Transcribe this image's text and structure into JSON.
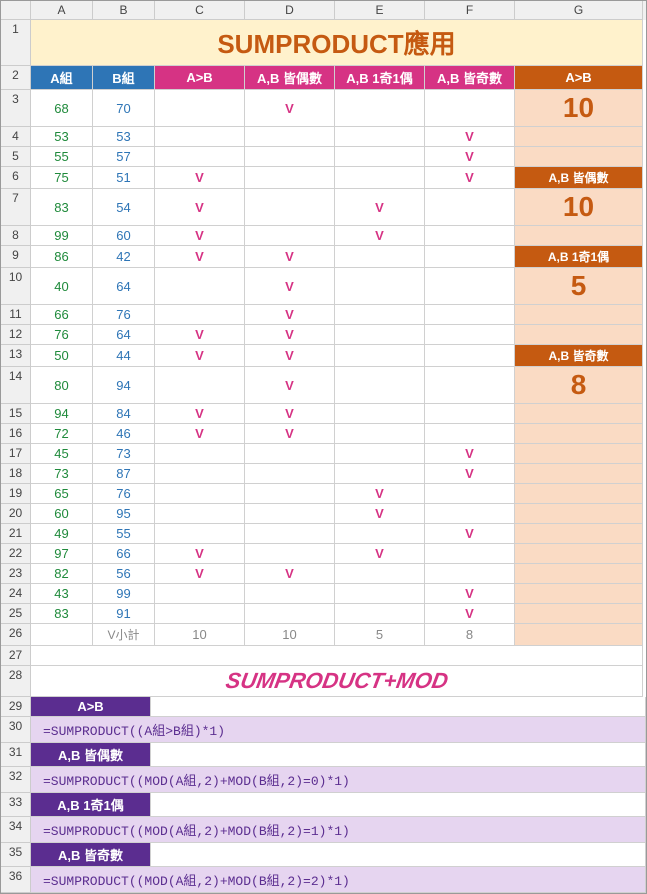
{
  "columns": [
    "",
    "A",
    "B",
    "C",
    "D",
    "E",
    "F",
    "G"
  ],
  "title": "SUMPRODUCT應用",
  "headers": {
    "a": "A組",
    "b": "B組",
    "c": "A>B",
    "d": "A,B 皆偶數",
    "e": "A,B 1奇1偶",
    "f": "A,B 皆奇數",
    "g": "A>B"
  },
  "rows": [
    {
      "n": 3,
      "a": 68,
      "b": 70,
      "c": "",
      "d": "V",
      "e": "",
      "f": ""
    },
    {
      "n": 4,
      "a": 53,
      "b": 53,
      "c": "",
      "d": "",
      "e": "",
      "f": "V"
    },
    {
      "n": 5,
      "a": 55,
      "b": 57,
      "c": "",
      "d": "",
      "e": "",
      "f": "V"
    },
    {
      "n": 6,
      "a": 75,
      "b": 51,
      "c": "V",
      "d": "",
      "e": "",
      "f": "V"
    },
    {
      "n": 7,
      "a": 83,
      "b": 54,
      "c": "V",
      "d": "",
      "e": "V",
      "f": ""
    },
    {
      "n": 8,
      "a": 99,
      "b": 60,
      "c": "V",
      "d": "",
      "e": "V",
      "f": ""
    },
    {
      "n": 9,
      "a": 86,
      "b": 42,
      "c": "V",
      "d": "V",
      "e": "",
      "f": ""
    },
    {
      "n": 10,
      "a": 40,
      "b": 64,
      "c": "",
      "d": "V",
      "e": "",
      "f": ""
    },
    {
      "n": 11,
      "a": 66,
      "b": 76,
      "c": "",
      "d": "V",
      "e": "",
      "f": ""
    },
    {
      "n": 12,
      "a": 76,
      "b": 64,
      "c": "V",
      "d": "V",
      "e": "",
      "f": ""
    },
    {
      "n": 13,
      "a": 50,
      "b": 44,
      "c": "V",
      "d": "V",
      "e": "",
      "f": ""
    },
    {
      "n": 14,
      "a": 80,
      "b": 94,
      "c": "",
      "d": "V",
      "e": "",
      "f": ""
    },
    {
      "n": 15,
      "a": 94,
      "b": 84,
      "c": "V",
      "d": "V",
      "e": "",
      "f": ""
    },
    {
      "n": 16,
      "a": 72,
      "b": 46,
      "c": "V",
      "d": "V",
      "e": "",
      "f": ""
    },
    {
      "n": 17,
      "a": 45,
      "b": 73,
      "c": "",
      "d": "",
      "e": "",
      "f": "V"
    },
    {
      "n": 18,
      "a": 73,
      "b": 87,
      "c": "",
      "d": "",
      "e": "",
      "f": "V"
    },
    {
      "n": 19,
      "a": 65,
      "b": 76,
      "c": "",
      "d": "",
      "e": "V",
      "f": ""
    },
    {
      "n": 20,
      "a": 60,
      "b": 95,
      "c": "",
      "d": "",
      "e": "V",
      "f": ""
    },
    {
      "n": 21,
      "a": 49,
      "b": 55,
      "c": "",
      "d": "",
      "e": "",
      "f": "V"
    },
    {
      "n": 22,
      "a": 97,
      "b": 66,
      "c": "V",
      "d": "",
      "e": "V",
      "f": ""
    },
    {
      "n": 23,
      "a": 82,
      "b": 56,
      "c": "V",
      "d": "V",
      "e": "",
      "f": ""
    },
    {
      "n": 24,
      "a": 43,
      "b": 99,
      "c": "",
      "d": "",
      "e": "",
      "f": "V"
    },
    {
      "n": 25,
      "a": 83,
      "b": 91,
      "c": "",
      "d": "",
      "e": "",
      "f": "V"
    }
  ],
  "side": {
    "g3_val": "10",
    "g6_lbl": "A,B 皆偶數",
    "g7_val": "10",
    "g9_lbl": "A,B 1奇1偶",
    "g10_val": "5",
    "g13_lbl": "A,B 皆奇數",
    "g14_val": "8"
  },
  "subtotal": {
    "label": "V小計",
    "c": "10",
    "d": "10",
    "e": "5",
    "f": "8"
  },
  "bigtext": "SUMPRODUCT+MOD",
  "labels": {
    "l1": "A>B",
    "l2": "A,B 皆偶數",
    "l3": "A,B 1奇1偶",
    "l4": "A,B 皆奇數"
  },
  "formulas": {
    "f1": "=SUMPRODUCT((A組>B組)*1)",
    "f2": "=SUMPRODUCT((MOD(A組,2)+MOD(B組,2)=0)*1)",
    "f3": "=SUMPRODUCT((MOD(A組,2)+MOD(B組,2)=1)*1)",
    "f4": "=SUMPRODUCT((MOD(A組,2)+MOD(B組,2)=2)*1)"
  },
  "rownums": {
    "r26": 26,
    "r27": 27,
    "r28": 28,
    "r29": 29,
    "r30": 30,
    "r31": 31,
    "r32": 32,
    "r33": 33,
    "r34": 34,
    "r35": 35,
    "r36": 36
  }
}
